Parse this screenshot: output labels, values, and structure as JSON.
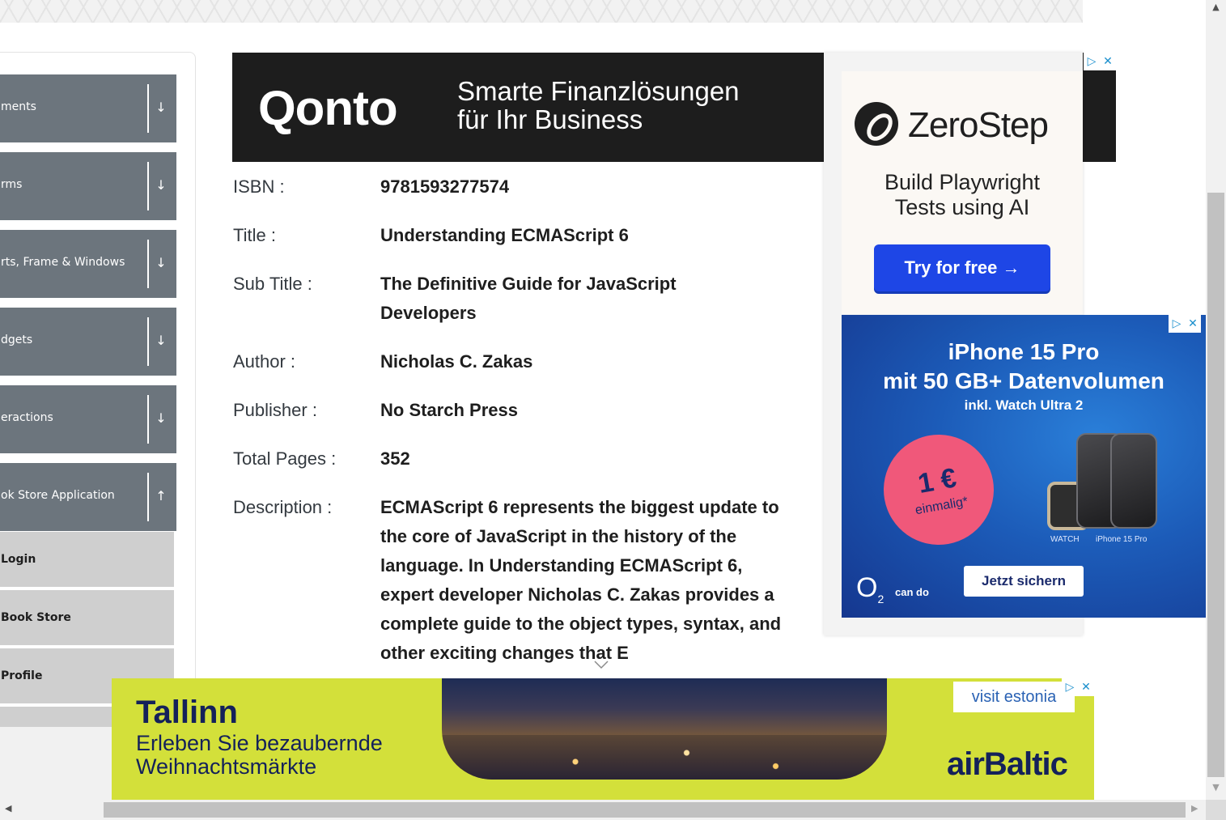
{
  "top_banner": {},
  "sidebar": {
    "groups": [
      {
        "label": "ments",
        "arrow": "↓"
      },
      {
        "label": "rms",
        "arrow": "↓"
      },
      {
        "label": "rts, Frame & Windows",
        "arrow": "↓"
      },
      {
        "label": "dgets",
        "arrow": "↓"
      },
      {
        "label": "eractions",
        "arrow": "↓"
      },
      {
        "label": "ok Store Application",
        "arrow": "↑"
      }
    ],
    "items": [
      {
        "label": "Login"
      },
      {
        "label": "Book Store"
      },
      {
        "label": "Profile"
      }
    ]
  },
  "ads": {
    "qonto": {
      "logo": "Qonto",
      "slogan_line1": "Smarte Finanzlösungen",
      "slogan_line2": "für Ihr Business"
    },
    "zerostep": {
      "brand": "ZeroStep",
      "tagline_line1": "Build Playwright",
      "tagline_line2": "Tests using AI",
      "cta": "Try for free →"
    },
    "iphone": {
      "headline_line1": "iPhone 15 Pro",
      "headline_line2": "mit 50 GB+ Datenvolumen",
      "subline": "inkl. Watch Ultra 2",
      "price": "1 €",
      "price_note": "einmalig*",
      "caption_watch": "WATCH",
      "caption_phone": "iPhone 15 Pro",
      "provider": "O",
      "provider_sub": "2",
      "provider_tag": "can do",
      "cta": "Jetzt sichern"
    },
    "tallinn": {
      "city": "Tallinn",
      "sub_line1": "Erleben Sie bezaubernde",
      "sub_line2": "Weihnachtsmärkte",
      "visit": "visit estonia",
      "brand": "airBaltic"
    },
    "adchoices_icon": "▷",
    "close_icon": "✕"
  },
  "book": {
    "isbn_label": "ISBN :",
    "isbn": "9781593277574",
    "title_label": "Title :",
    "title": "Understanding ECMAScript 6",
    "subtitle_label": "Sub Title :",
    "subtitle": "The Definitive Guide for JavaScript Developers",
    "author_label": "Author :",
    "author": "Nicholas C. Zakas",
    "publisher_label": "Publisher :",
    "publisher": "No Starch Press",
    "pages_label": "Total Pages :",
    "pages": "352",
    "description_label": "Description :",
    "description": "ECMAScript 6 represents the biggest update to the core of JavaScript in the history of the language. In Understanding ECMAScript 6, expert developer Nicholas C. Zakas provides a complete guide to the object types, syntax, and other exciting changes that E"
  },
  "scrollbars": {
    "up": "▲",
    "down": "▼",
    "left": "◀",
    "right": "▶"
  }
}
